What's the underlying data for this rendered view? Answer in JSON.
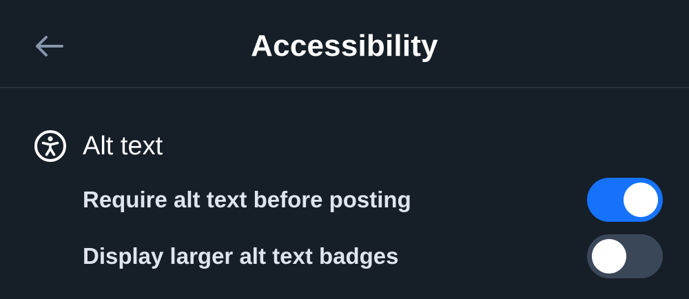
{
  "header": {
    "title": "Accessibility",
    "back_icon": "arrow-left-icon"
  },
  "section": {
    "title": "Alt text",
    "icon": "accessibility-icon"
  },
  "settings": [
    {
      "label": "Require alt text before posting",
      "enabled": true
    },
    {
      "label": "Display larger alt text badges",
      "enabled": false
    }
  ],
  "colors": {
    "background": "#161e27",
    "divider": "#262f3a",
    "toggle_on": "#1672fb",
    "toggle_off": "#3a4759",
    "back_icon": "#8696ab"
  }
}
